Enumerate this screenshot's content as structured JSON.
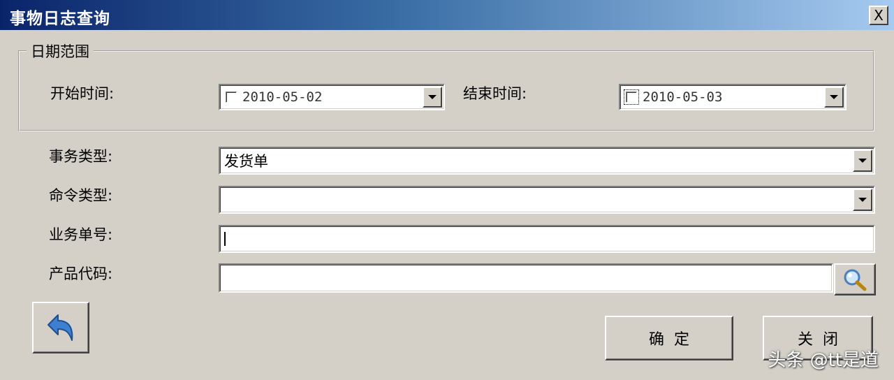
{
  "window": {
    "title": "事物日志查询",
    "close_label": "X"
  },
  "date_range": {
    "legend": "日期范围",
    "start_label": "开始时间:",
    "start_value": "2010-05-02",
    "end_label": "结束时间:",
    "end_value": "2010-05-03"
  },
  "form": {
    "transaction_type_label": "事务类型:",
    "transaction_type_value": "发货单",
    "command_type_label": "命令类型:",
    "command_type_value": "",
    "business_number_label": "业务单号:",
    "business_number_value": "",
    "product_code_label": "产品代码:",
    "product_code_value": ""
  },
  "buttons": {
    "confirm": "确定",
    "close": "关闭"
  },
  "watermark": "头条 @tt是道",
  "icons": [
    "close-icon",
    "dropdown-arrow-icon",
    "magnifier-icon",
    "back-arrow-icon"
  ],
  "colors": {
    "dialog_bg": "#d4d0c8",
    "title_start": "#0a246a",
    "title_end": "#a6caf0",
    "title_text": "#ffffff",
    "back_arrow": "#3f7fd0"
  }
}
